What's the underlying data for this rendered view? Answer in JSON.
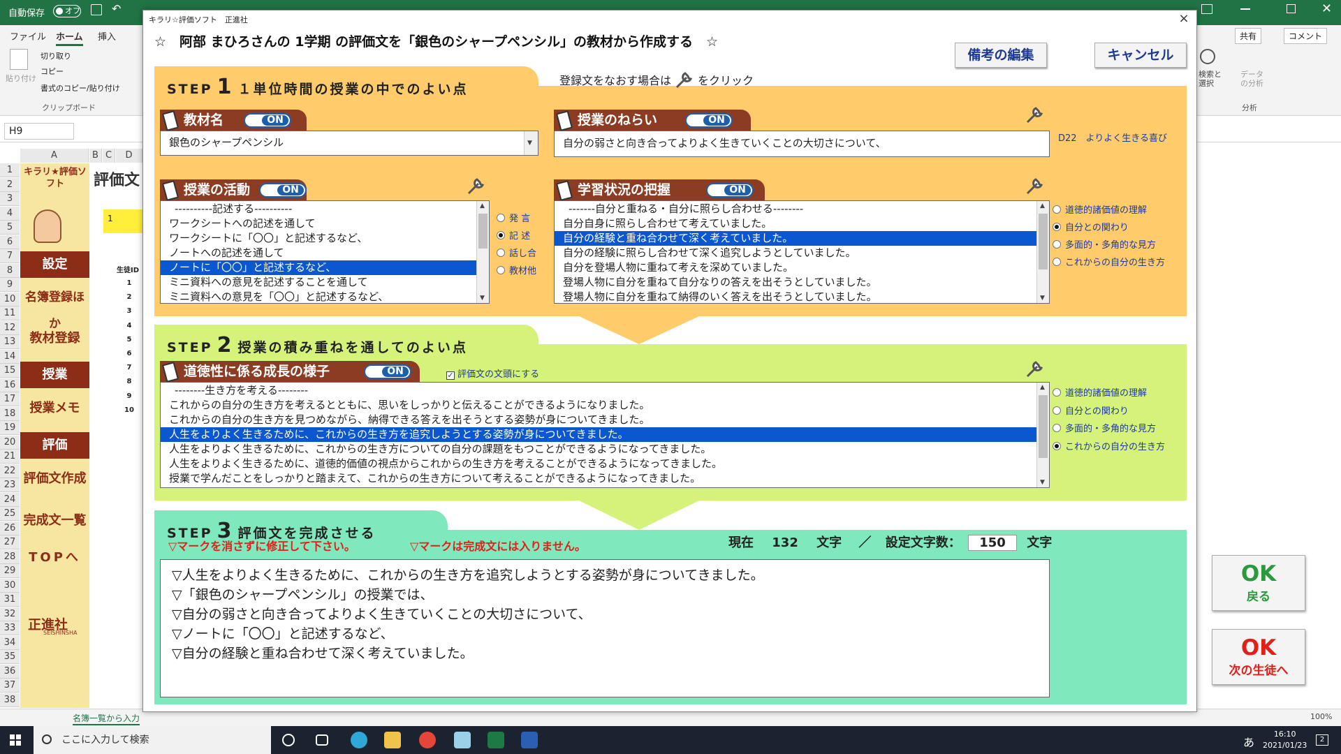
{
  "excel": {
    "autosave_label": "自動保存",
    "autosave_state": "オフ",
    "ribbon_tabs": [
      "ファイル",
      "ホーム",
      "挿入"
    ],
    "clipboard": {
      "paste": "貼り付け",
      "cut": "切り取り",
      "copy": "コピー",
      "format_painter": "書式のコピー/貼り付け",
      "group": "クリップボード"
    },
    "share": "共有",
    "comment": "コメント",
    "search_select": "検索と選択",
    "data_analysis": "データの分析",
    "analysis_group": "分析",
    "namebox": "H9",
    "columns": [
      "A",
      "B",
      "C",
      "D"
    ],
    "rows": [
      "1",
      "2",
      "3",
      "4",
      "5",
      "6",
      "7",
      "8",
      "9",
      "10",
      "11",
      "12",
      "13",
      "14",
      "15",
      "16",
      "17",
      "18",
      "19",
      "20",
      "21",
      "22",
      "23",
      "24",
      "25",
      "26",
      "27",
      "28",
      "29",
      "30",
      "31",
      "32",
      "33",
      "34",
      "35",
      "36",
      "37",
      "38"
    ],
    "sheet_title": "評価文",
    "sheet_field": "1",
    "student_col_header": "生徒ID",
    "student_nums": [
      "1",
      "2",
      "3",
      "4",
      "5",
      "6",
      "7",
      "8",
      "9",
      "10"
    ],
    "logo": "キラリ★評価ソフト",
    "side_menu": [
      "設定",
      "名簿登録ほか",
      "教材登録",
      "授業",
      "授業メモ",
      "評価",
      "評価文作成",
      "完成文一覧",
      "TOPへ"
    ],
    "publisher": "正進社",
    "publisher_en": "SEISHINSHA",
    "sheet_tab": "名簿一覧から入力",
    "zoom": "100%",
    "taskbar_search": "ここに入力して検索",
    "time": "16:10",
    "date": "2021/01/23",
    "ime": "あ",
    "notif_count": "2"
  },
  "dialog": {
    "title": "キラリ☆評価ソフト　正進社",
    "close": "×",
    "header": "☆　阿部 まひろさんの 1学期 の評価文を「銀色のシャープペンシル」の教材から作成する　☆",
    "btn_note": "備考の編集",
    "btn_cancel": "キャンセル",
    "step1": {
      "step_word": "STEP",
      "num": "1",
      "title": "１単位時間の授業の中でのよい点",
      "hint": "登録文をなおす場合は",
      "hint2": "をクリック",
      "material_label": "教材名",
      "material_value": "銀色のシャープペンシル",
      "aim_label": "授業のねらい",
      "aim_value": "自分の弱さと向き合ってよりよく生きていくことの大切さについて、",
      "aim_code": "D22　よりよく生きる喜び",
      "activity_label": "授業の活動",
      "activity_lines": [
        "----------記述する----------",
        "ワークシートへの記述を通して",
        "ワークシートに「〇〇」と記述するなど、",
        "ノートへの記述を通して",
        "ノートに「〇〇」と記述するなど、",
        "ミニ資料への意見を記述することを通して",
        "ミニ資料への意見を「〇〇」と記述するなど、"
      ],
      "activity_selected": 4,
      "activity_radios": [
        "発 言",
        "記 述",
        "話し合",
        "教材他"
      ],
      "activity_radio_selected": 1,
      "status_label": "学習状況の把握",
      "status_lines": [
        "-------自分と重ねる・自分に照らし合わせる--------",
        "自分自身に照らし合わせて考えていました。",
        "自分の経験と重ね合わせて深く考えていました。",
        "自分の経験に照らし合わせて深く追究しようとしていました。",
        "自分を登場人物に重ねて考えを深めていました。",
        "登場人物に自分を重ねて自分なりの答えを出そうとしていました。",
        "登場人物に自分を重ねて納得のいく答えを出そうとしていました。"
      ],
      "status_selected": 2,
      "status_radios": [
        "道徳的諸価値の理解",
        "自分との関わり",
        "多面的・多角的な見方",
        "これからの自分の生き方"
      ],
      "status_radio_selected": 1
    },
    "step2": {
      "step_word": "STEP",
      "num": "2",
      "title": "授業の積み重ねを通してのよい点",
      "growth_label": "道徳性に係る成長の様子",
      "checkbox_label": "評価文の文頭にする",
      "growth_lines": [
        "--------生き方を考える--------",
        "これからの自分の生き方を考えるとともに、思いをしっかりと伝えることができるようになりました。",
        "これからの自分の生き方を見つめながら、納得できる答えを出そうとする姿勢が身についてきました。",
        "人生をよりよく生きるために、これからの生き方を追究しようとする姿勢が身についてきました。",
        "人生をよりよく生きるために、これからの生き方についての自分の課題をもつことができるようになってきました。",
        "人生をよりよく生きるために、道徳的価値の視点からこれからの生き方を考えることができるようになってきました。",
        "授業で学んだことをしっかりと踏まえて、これからの生き方について考えることができるようになってきました。"
      ],
      "growth_selected": 3,
      "growth_radios": [
        "道徳的諸価値の理解",
        "自分との関わり",
        "多面的・多角的な見方",
        "これからの自分の生き方"
      ],
      "growth_radio_selected": 3
    },
    "step3": {
      "step_word": "STEP",
      "num": "3",
      "title": "評価文を完成させる",
      "warn1": "▽マークを消さずに修正して下さい。",
      "warn2": "▽マークは完成文には入りません。",
      "count_label": "現在",
      "count_value": "132",
      "count_unit": "文字",
      "slash": "／",
      "limit_label": "設定文字数：",
      "limit_value": "150",
      "limit_unit": "文字",
      "final_lines": [
        "▽人生をよりよく生きるために、これからの生き方を追究しようとする姿勢が身についてきました。",
        "▽「銀色のシャープペンシル」の授業では、",
        "▽自分の弱さと向き合ってよりよく生きていくことの大切さについて、",
        "▽ノートに「〇〇」と記述するなど、",
        "▽自分の経験と重ね合わせて深く考えていました。"
      ],
      "ok1": "OK",
      "ok1_sub": "戻る",
      "ok2": "OK",
      "ok2_sub": "次の生徒へ"
    },
    "on_label": "ON"
  }
}
